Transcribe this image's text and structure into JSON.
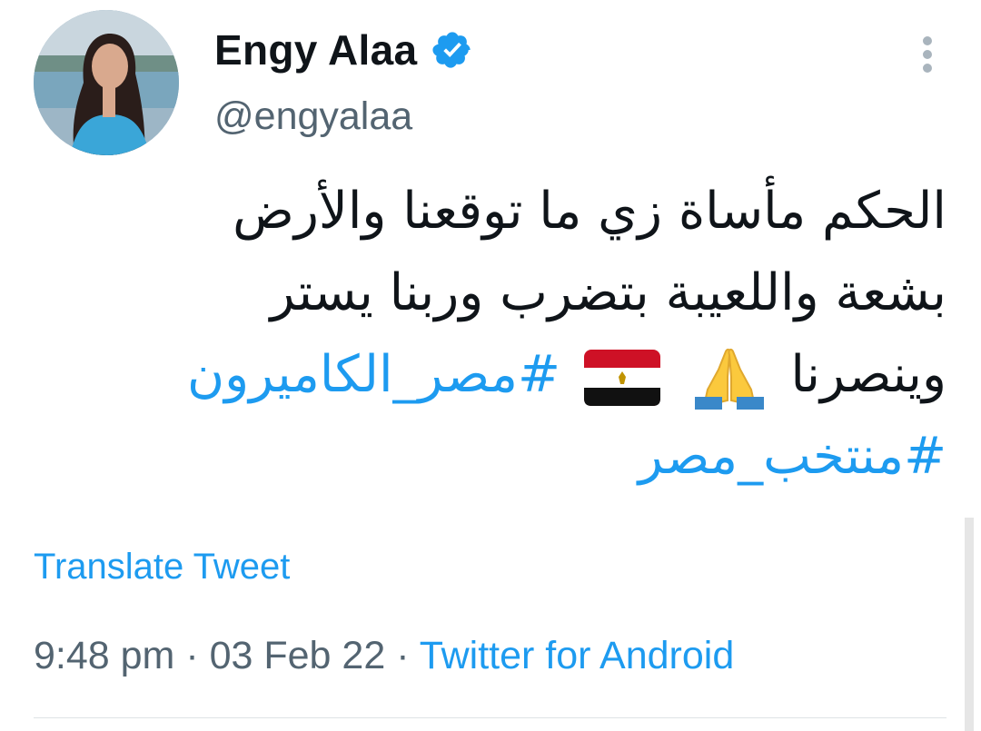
{
  "user": {
    "display_name": "Engy Alaa",
    "handle": "@engyalaa",
    "verified": true
  },
  "tweet": {
    "line1": "الحكم مأساة زي ما توقعنا والأرض",
    "line2": "بشعة واللعيبة بتضرب وربنا يستر",
    "line3_text": "وينصرنا",
    "hashtag1": "#مصر_الكاميرون",
    "hashtag2": "#منتخب_مصر",
    "emojis": [
      "folded-hands-icon",
      "egypt-flag-icon"
    ]
  },
  "translate_label": "Translate Tweet",
  "meta": {
    "time": "9:48 pm",
    "separator": " · ",
    "date": "03 Feb 22",
    "source": "Twitter for Android"
  },
  "colors": {
    "link": "#1d9bf0",
    "text": "#0f1419",
    "secondary": "#536471",
    "verified": "#1d9bf0"
  }
}
